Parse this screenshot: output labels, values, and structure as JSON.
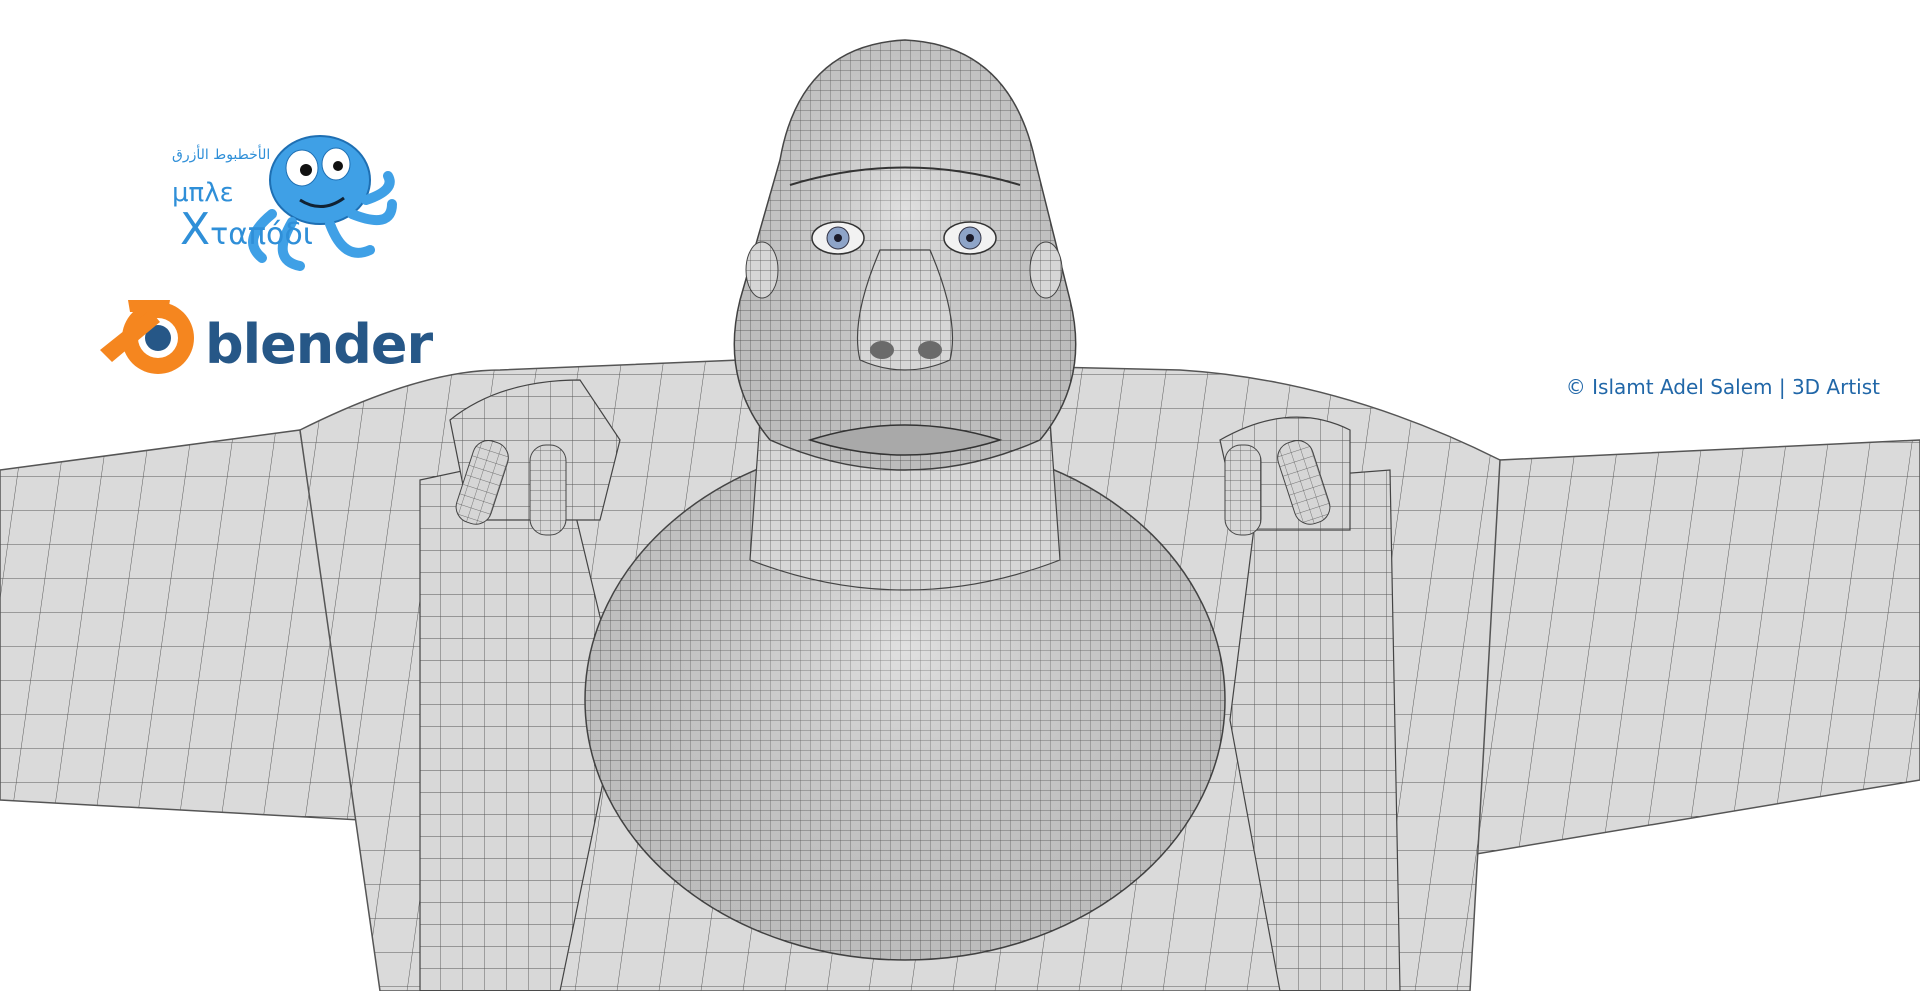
{
  "image": {
    "subject": "3D wireframe model",
    "background_color": "#ffffff",
    "model_color": "#d9d9d9",
    "wire_color": "#4a4a4a"
  },
  "logos": {
    "greek_line1": "μπλε",
    "greek_line2_cap": "Χ",
    "greek_line2_rest": "ταπόδι",
    "arabic_text": "الأخطبوط الأزرق",
    "blender_word": "blender",
    "accent_blue": "#2f8fd8",
    "blender_orange": "#f5861f",
    "blender_blue": "#265787"
  },
  "credit": {
    "text": "© Islamt Adel Salem | 3D Artist",
    "color": "#2167a8"
  }
}
